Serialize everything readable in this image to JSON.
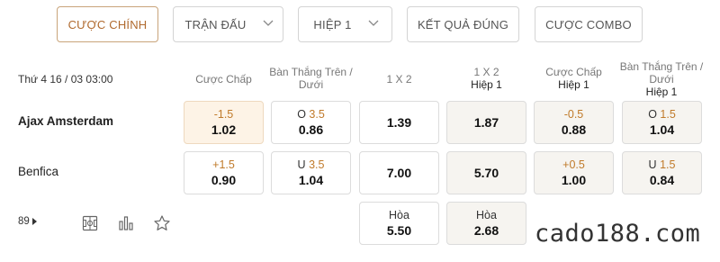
{
  "tabs": [
    {
      "label": "CƯỢC CHÍNH",
      "active": true
    },
    {
      "label": "TRẬN ĐẤU",
      "dropdown": true
    },
    {
      "label": "HIỆP 1",
      "dropdown": true
    },
    {
      "label": "KẾT QUẢ ĐÚNG"
    },
    {
      "label": "CƯỢC COMBO"
    }
  ],
  "match": {
    "datetime": "Thứ 4 16 / 03 03:00",
    "home": "Ajax Amsterdam",
    "away": "Benfica",
    "more_count": "89"
  },
  "columns": [
    {
      "title": "Cược Chấp",
      "sub": ""
    },
    {
      "title": "Bàn Thắng Trên / Dưới",
      "sub": ""
    },
    {
      "title": "1 X 2",
      "sub": ""
    },
    {
      "title": "1 X 2",
      "sub": "Hiệp 1"
    },
    {
      "title": "Cược Chấp",
      "sub": "Hiệp 1"
    },
    {
      "title": "Bàn Thắng Trên / Dưới",
      "sub": "Hiệp 1"
    }
  ],
  "odds": {
    "home": {
      "handicap": {
        "line": "-1.5",
        "odd": "1.02"
      },
      "ou": {
        "side": "O",
        "line": "3.5",
        "odd": "0.86"
      },
      "x12": {
        "odd": "1.39"
      },
      "x12_h1": {
        "odd": "1.87"
      },
      "handicap_h1": {
        "line": "-0.5",
        "odd": "0.88"
      },
      "ou_h1": {
        "side": "O",
        "line": "1.5",
        "odd": "1.04"
      }
    },
    "away": {
      "handicap": {
        "line": "+1.5",
        "odd": "0.90"
      },
      "ou": {
        "side": "U",
        "line": "3.5",
        "odd": "1.04"
      },
      "x12": {
        "odd": "7.00"
      },
      "x12_h1": {
        "odd": "5.70"
      },
      "handicap_h1": {
        "line": "+0.5",
        "odd": "1.00"
      },
      "ou_h1": {
        "side": "U",
        "line": "1.5",
        "odd": "0.84"
      }
    },
    "draw": {
      "x12": {
        "label": "Hòa",
        "odd": "5.50"
      },
      "x12_h1": {
        "label": "Hòa",
        "odd": "2.68"
      }
    }
  },
  "icons": [
    "field-icon",
    "stats-bar-icon",
    "star-icon"
  ],
  "watermark": "cado188.com",
  "colors": {
    "accent": "#c07a2a",
    "active_border": "#c9a47a",
    "highlight_cell": "#fdf3e6"
  }
}
